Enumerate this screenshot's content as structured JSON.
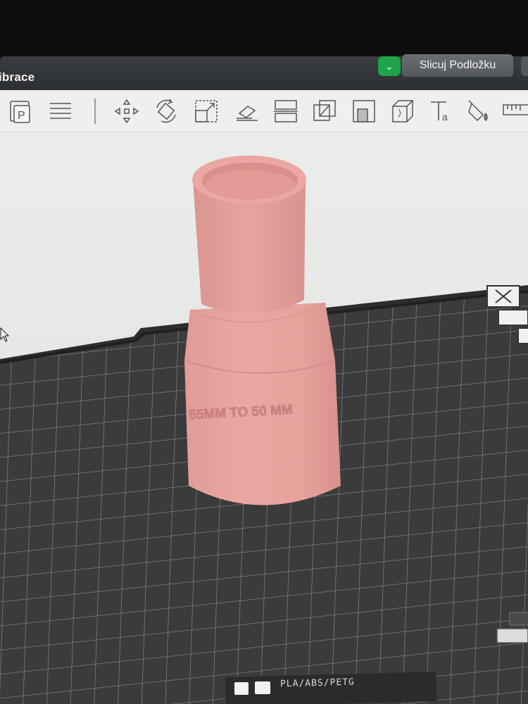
{
  "window": {
    "tab_title": "ibrace",
    "slice_toggle_icon": "chevron-down-icon",
    "slice_button_label": "Slicuj Podložku",
    "accent_color": "#1fa34a"
  },
  "toolbar": {
    "tools": [
      "plate-icon",
      "arrange-icon",
      "move-icon",
      "rotate-icon",
      "scale-icon",
      "lay-on-face-icon",
      "split-icon",
      "cut-icon",
      "support-paint-icon",
      "seam-paint-icon",
      "mesh-boolean-icon",
      "text-icon",
      "paint-icon",
      "measure-icon"
    ]
  },
  "viewport": {
    "model_color": "#e9a4a0",
    "model_label": "55MM TO 50 MM",
    "bed_filament_label": "PLA/ABS/PETG"
  }
}
